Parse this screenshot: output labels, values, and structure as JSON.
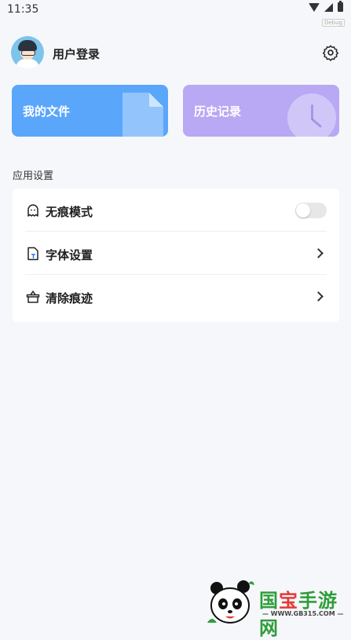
{
  "status_bar": {
    "time": "11:35",
    "corner_tag": "Debug"
  },
  "header": {
    "username": "用户登录"
  },
  "cards": [
    {
      "label": "我的文件",
      "color": "#5aa6fb",
      "icon": "document-icon"
    },
    {
      "label": "历史记录",
      "color": "#b9a8f4",
      "icon": "clock-icon"
    }
  ],
  "section_title": "应用设置",
  "settings": [
    {
      "label": "无痕模式",
      "icon": "ghost-icon",
      "control": "toggle",
      "enabled": false
    },
    {
      "label": "字体设置",
      "icon": "font-file-icon",
      "control": "chevron"
    },
    {
      "label": "清除痕迹",
      "icon": "basket-icon",
      "control": "chevron"
    }
  ],
  "watermark": {
    "title_1": "国",
    "title_2": "宝",
    "title_3": "手游网",
    "url": "— WWW.GB315.COM —"
  }
}
